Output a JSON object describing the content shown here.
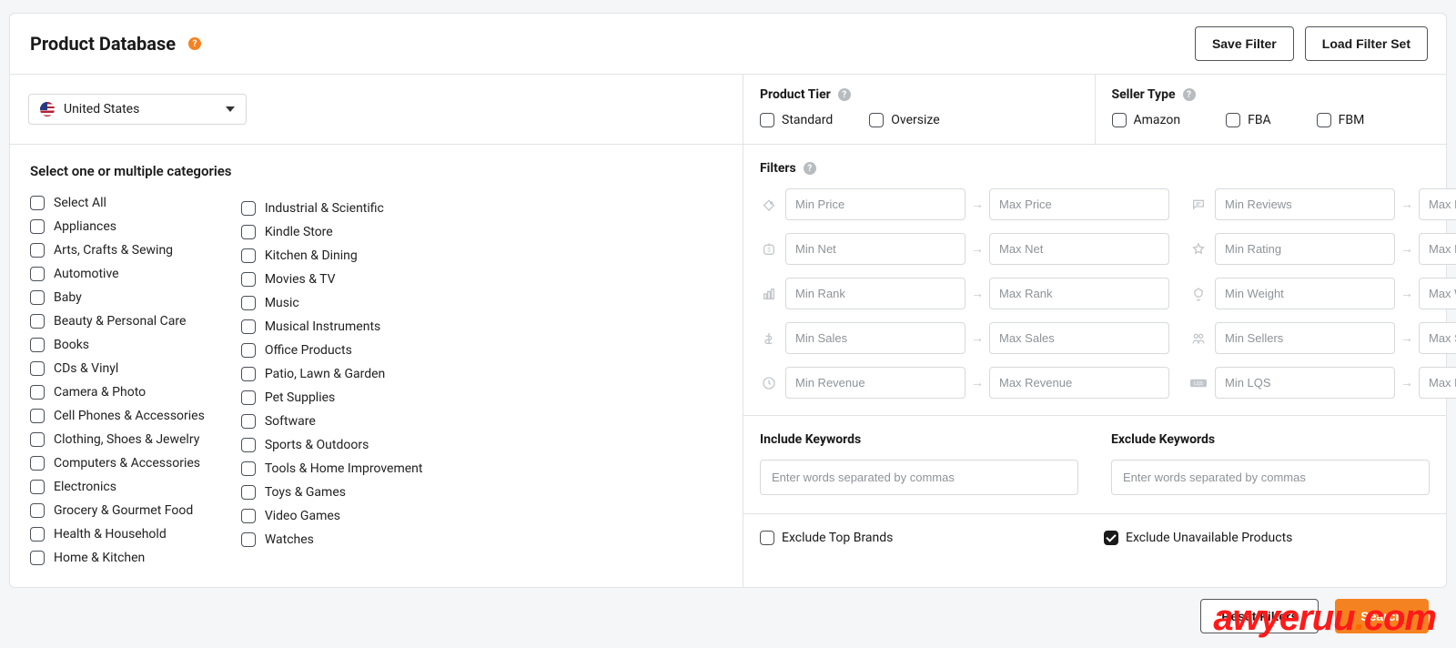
{
  "header": {
    "title": "Product Database",
    "save": "Save Filter",
    "load": "Load Filter Set"
  },
  "country": {
    "selected": "United States"
  },
  "categories": {
    "title": "Select one or multiple categories",
    "col1": [
      "Select All",
      "Appliances",
      "Arts, Crafts & Sewing",
      "Automotive",
      "Baby",
      "Beauty & Personal Care",
      "Books",
      "CDs & Vinyl",
      "Camera & Photo",
      "Cell Phones & Accessories",
      "Clothing, Shoes & Jewelry",
      "Computers & Accessories",
      "Electronics",
      "Grocery & Gourmet Food",
      "Health & Household",
      "Home & Kitchen"
    ],
    "col2": [
      "Industrial & Scientific",
      "Kindle Store",
      "Kitchen & Dining",
      "Movies & TV",
      "Music",
      "Musical Instruments",
      "Office Products",
      "Patio, Lawn & Garden",
      "Pet Supplies",
      "Software",
      "Sports & Outdoors",
      "Tools & Home Improvement",
      "Toys & Games",
      "Video Games",
      "Watches"
    ]
  },
  "product_tier": {
    "label": "Product Tier",
    "options": [
      "Standard",
      "Oversize"
    ]
  },
  "seller_type": {
    "label": "Seller Type",
    "options": [
      "Amazon",
      "FBA",
      "FBM"
    ]
  },
  "filters": {
    "label": "Filters",
    "left": [
      {
        "min": "Min Price",
        "max": "Max Price"
      },
      {
        "min": "Min Net",
        "max": "Max Net"
      },
      {
        "min": "Min Rank",
        "max": "Max Rank"
      },
      {
        "min": "Min Sales",
        "max": "Max Sales"
      },
      {
        "min": "Min Revenue",
        "max": "Max Revenue"
      }
    ],
    "right": [
      {
        "min": "Min Reviews",
        "max": "Max Reviews"
      },
      {
        "min": "Min Rating",
        "max": "Max Rating"
      },
      {
        "min": "Min Weight",
        "max": "Max Weight"
      },
      {
        "min": "Min Sellers",
        "max": "Max Sellers"
      },
      {
        "min": "Min LQS",
        "max": "Max LQS"
      }
    ]
  },
  "include_kw": {
    "label": "Include Keywords",
    "placeholder": "Enter words separated by commas"
  },
  "exclude_kw": {
    "label": "Exclude Keywords",
    "placeholder": "Enter words separated by commas"
  },
  "exclude_top_brands": "Exclude Top Brands",
  "exclude_unavailable": "Exclude Unavailable Products",
  "footer": {
    "reset": "Reset Filters",
    "search": "Search"
  },
  "watermark": {
    "a": "awyeruu",
    "b": ".",
    "c": "com"
  }
}
